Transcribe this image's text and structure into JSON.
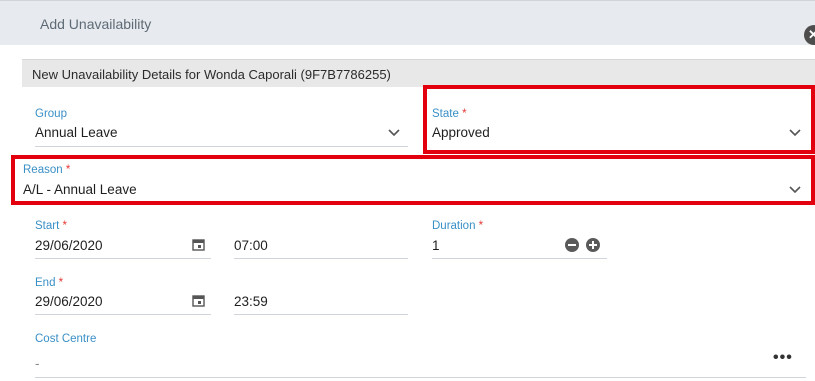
{
  "dialog": {
    "title": "Add Unavailability",
    "close_icon": "close-circle-icon"
  },
  "details_header": "New Unavailability Details for Wonda Caporali (9F7B7786255)",
  "fields": {
    "group": {
      "label": "Group",
      "value": "Annual Leave",
      "required": false
    },
    "state": {
      "label": "State",
      "value": "Approved",
      "required": true
    },
    "reason": {
      "label": "Reason",
      "value": "A/L - Annual Leave",
      "required": true
    },
    "start": {
      "label": "Start",
      "date": "29/06/2020",
      "time": "07:00",
      "required": true
    },
    "duration": {
      "label": "Duration",
      "value": "1",
      "required": true
    },
    "end": {
      "label": "End",
      "date": "29/06/2020",
      "time": "23:59",
      "required": true
    },
    "cost_centre": {
      "label": "Cost Centre",
      "value": "-",
      "required": false
    }
  },
  "required_marker": "*",
  "more_label": "•••",
  "colors": {
    "highlight": "#e2000f",
    "label": "#3a8fc7",
    "required": "#e53935",
    "titlebar": "#e7ebef"
  }
}
